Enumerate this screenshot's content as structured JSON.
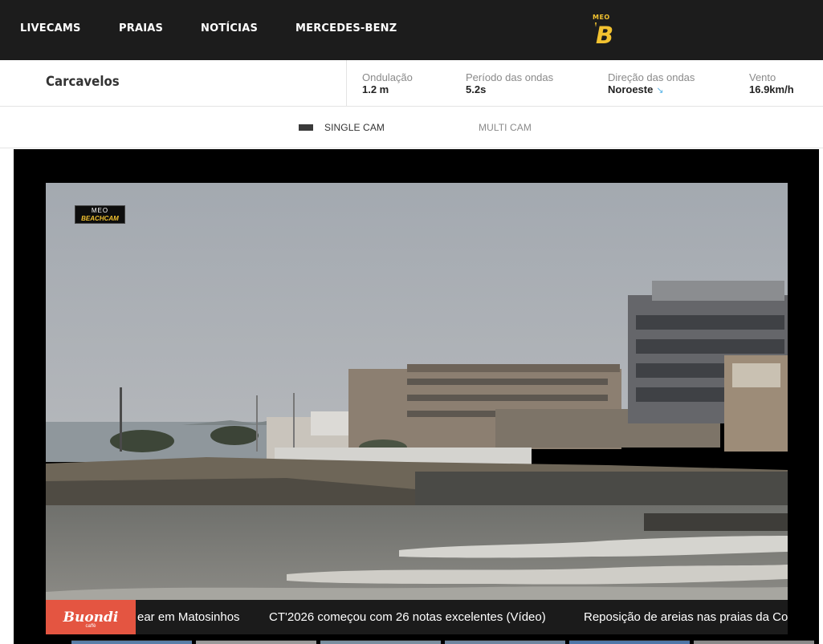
{
  "nav": {
    "items": [
      "LIVECAMS",
      "PRAIAS",
      "NOTÍCIAS",
      "MERCEDES-BENZ"
    ],
    "logo_top": "MEO",
    "logo_main": "B"
  },
  "beach": {
    "name": "Carcavelos",
    "stats": [
      {
        "label": "Ondulação",
        "value": "1.2 m"
      },
      {
        "label": "Período das ondas",
        "value": "5.2s"
      },
      {
        "label": "Direção das ondas",
        "value": "Noroeste",
        "icon": "arrow-down-right-icon"
      },
      {
        "label": "Vento",
        "value": "16.9km/h"
      }
    ]
  },
  "views": {
    "single_label": "SINGLE CAM",
    "multi_label": "MULTI CAM"
  },
  "camera": {
    "badge_top": "MEO",
    "badge_bottom": "BEACHCAM"
  },
  "ticker": {
    "sponsor_name": "Buondi",
    "sponsor_sub": "caffè",
    "items": [
      "ear em Matosinhos",
      "CT'2026 começou com 26 notas excelentes (Vídeo)",
      "Reposição de areias nas praias da Co"
    ]
  },
  "colors": {
    "nav_bg": "#1c1c1c",
    "logo_yellow": "#f2c230",
    "sponsor_red": "#e45541",
    "ticker_bg": "#1b1b1b"
  }
}
